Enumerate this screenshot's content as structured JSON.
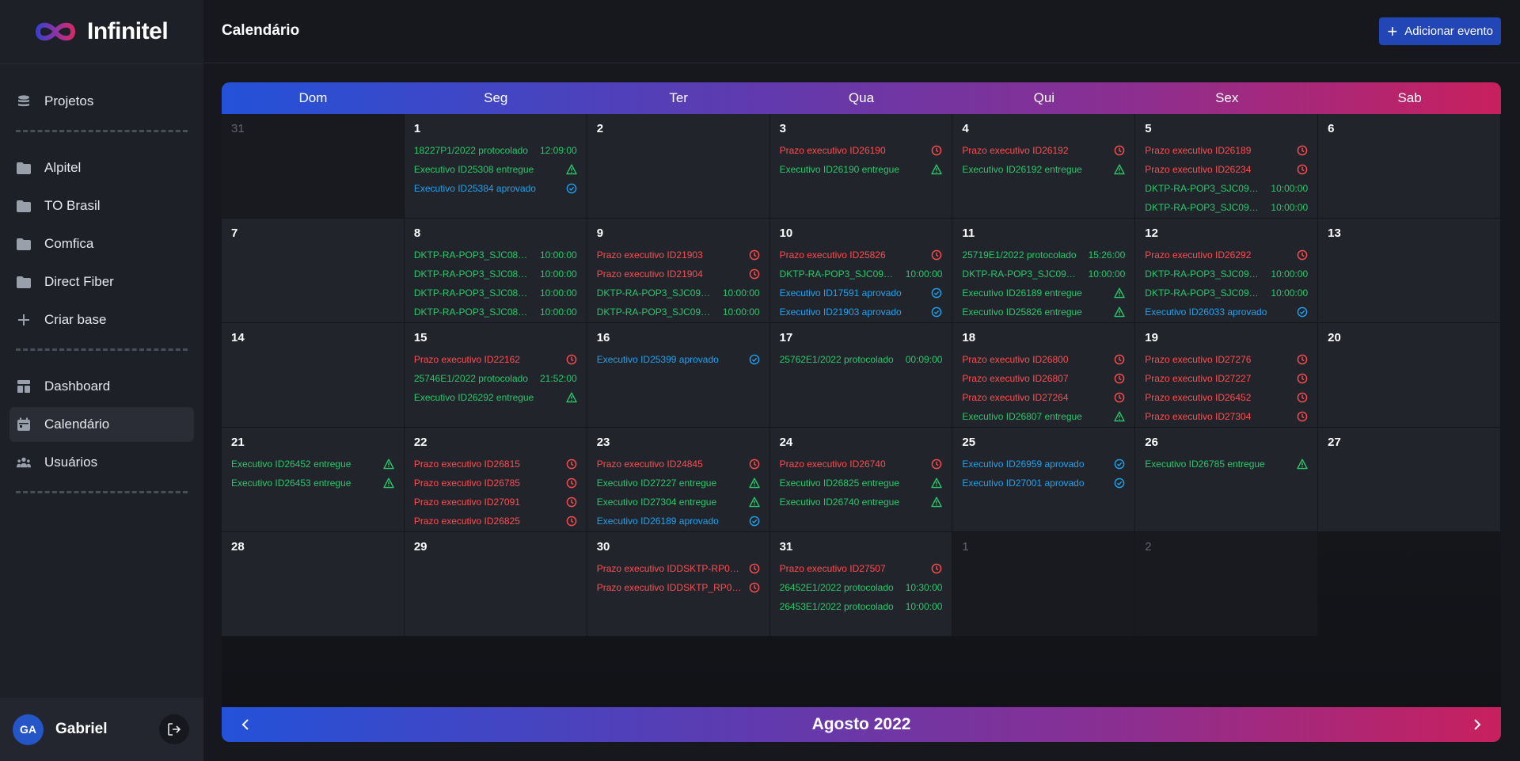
{
  "app": {
    "name": "Infinitel"
  },
  "colors": {
    "red": "#ff4d4f",
    "green": "#27c96a",
    "blue": "#1fa2ef",
    "accent": "#2346b6"
  },
  "sidebar": {
    "items_top": [
      {
        "label": "Projetos",
        "icon": "database-icon"
      }
    ],
    "items_projects": [
      {
        "label": "Alpitel",
        "icon": "folder-icon"
      },
      {
        "label": "TO Brasil",
        "icon": "folder-icon"
      },
      {
        "label": "Comfica",
        "icon": "folder-icon"
      },
      {
        "label": "Direct Fiber",
        "icon": "folder-icon"
      },
      {
        "label": "Criar base",
        "icon": "plus-icon"
      }
    ],
    "items_bottom": [
      {
        "label": "Dashboard",
        "icon": "dashboard-icon",
        "active": false
      },
      {
        "label": "Calendário",
        "icon": "calendar-icon",
        "active": true
      },
      {
        "label": "Usuários",
        "icon": "users-icon",
        "active": false
      }
    ],
    "user": {
      "initials": "GA",
      "name": "Gabriel"
    }
  },
  "header": {
    "title": "Calendário",
    "add_button": "Adicionar evento"
  },
  "calendar": {
    "month_label": "Agosto 2022",
    "weekdays": [
      "Dom",
      "Seg",
      "Ter",
      "Qua",
      "Qui",
      "Sex",
      "Sab"
    ],
    "weeks": [
      [
        {
          "day": "31",
          "outside": true,
          "events": []
        },
        {
          "day": "1",
          "events": [
            {
              "label": "18227P1/2022 protocolado",
              "time": "12:09:00",
              "type": "green"
            },
            {
              "label": "Executivo ID25308 entregue",
              "icon": "warning-icon",
              "type": "green"
            },
            {
              "label": "Executivo ID25384 aprovado",
              "icon": "check-icon",
              "type": "blue"
            }
          ]
        },
        {
          "day": "2",
          "events": []
        },
        {
          "day": "3",
          "events": [
            {
              "label": "Prazo executivo ID26190",
              "icon": "clock-icon",
              "type": "red"
            },
            {
              "label": "Executivo ID26190 entregue",
              "icon": "warning-icon",
              "type": "green"
            }
          ]
        },
        {
          "day": "4",
          "events": [
            {
              "label": "Prazo executivo ID26192",
              "icon": "clock-icon",
              "type": "red"
            },
            {
              "label": "Executivo ID26192 entregue",
              "icon": "warning-icon",
              "type": "green"
            }
          ]
        },
        {
          "day": "5",
          "events": [
            {
              "label": "Prazo executivo ID26189",
              "icon": "clock-icon",
              "type": "red"
            },
            {
              "label": "Prazo executivo ID26234",
              "icon": "clock-icon",
              "type": "red"
            },
            {
              "label": "DKTP-RA-POP3_SJC09E1/...",
              "time": "10:00:00",
              "type": "green"
            },
            {
              "label": "DKTP-RA-POP3_SJC09E1/...",
              "time": "10:00:00",
              "type": "green"
            }
          ]
        },
        {
          "day": "6",
          "events": []
        }
      ],
      [
        {
          "day": "7",
          "events": []
        },
        {
          "day": "8",
          "events": [
            {
              "label": "DKTP-RA-POP3_SJC08E6/...",
              "time": "10:00:00",
              "type": "green"
            },
            {
              "label": "DKTP-RA-POP3_SJC08E7/...",
              "time": "10:00:00",
              "type": "green"
            },
            {
              "label": "DKTP-RA-POP3_SJC08E8/...",
              "time": "10:00:00",
              "type": "green"
            },
            {
              "label": "DKTP-RA-POP3_SJC08E9/...",
              "time": "10:00:00",
              "type": "green"
            }
          ]
        },
        {
          "day": "9",
          "events": [
            {
              "label": "Prazo executivo ID21903",
              "icon": "clock-icon",
              "type": "red"
            },
            {
              "label": "Prazo executivo ID21904",
              "icon": "clock-icon",
              "type": "red"
            },
            {
              "label": "DKTP-RA-POP3_SJC09E2/...",
              "time": "10:00:00",
              "type": "green"
            },
            {
              "label": "DKTP-RA-POP3_SJC09E3/...",
              "time": "10:00:00",
              "type": "green"
            }
          ]
        },
        {
          "day": "10",
          "events": [
            {
              "label": "Prazo executivo ID25826",
              "icon": "clock-icon",
              "type": "red"
            },
            {
              "label": "DKTP-RA-POP3_SJC09E4/...",
              "time": "10:00:00",
              "type": "green"
            },
            {
              "label": "Executivo ID17591 aprovado",
              "icon": "check-icon",
              "type": "blue"
            },
            {
              "label": "Executivo ID21903 aprovado",
              "icon": "check-icon",
              "type": "blue"
            }
          ]
        },
        {
          "day": "11",
          "events": [
            {
              "label": "25719E1/2022 protocolado",
              "time": "15:26:00",
              "type": "green"
            },
            {
              "label": "DKTP-RA-POP3_SJC09E5/...",
              "time": "10:00:00",
              "type": "green"
            },
            {
              "label": "Executivo ID26189 entregue",
              "icon": "warning-icon",
              "type": "green"
            },
            {
              "label": "Executivo ID25826 entregue",
              "icon": "warning-icon",
              "type": "green"
            }
          ]
        },
        {
          "day": "12",
          "events": [
            {
              "label": "Prazo executivo ID26292",
              "icon": "clock-icon",
              "type": "red"
            },
            {
              "label": "DKTP-RA-POP3_SJC09E6/...",
              "time": "10:00:00",
              "type": "green"
            },
            {
              "label": "DKTP-RA-POP3_SJC09E7/...",
              "time": "10:00:00",
              "type": "green"
            },
            {
              "label": "Executivo ID26033 aprovado",
              "icon": "check-icon",
              "type": "blue"
            }
          ]
        },
        {
          "day": "13",
          "events": []
        }
      ],
      [
        {
          "day": "14",
          "events": []
        },
        {
          "day": "15",
          "events": [
            {
              "label": "Prazo executivo ID22162",
              "icon": "clock-icon",
              "type": "red"
            },
            {
              "label": "25746E1/2022 protocolado",
              "time": "21:52:00",
              "type": "green"
            },
            {
              "label": "Executivo ID26292 entregue",
              "icon": "warning-icon",
              "type": "green"
            }
          ]
        },
        {
          "day": "16",
          "events": [
            {
              "label": "Executivo ID25399 aprovado",
              "icon": "check-icon",
              "type": "blue"
            }
          ]
        },
        {
          "day": "17",
          "events": [
            {
              "label": "25762E1/2022 protocolado",
              "time": "00:09:00",
              "type": "green"
            }
          ]
        },
        {
          "day": "18",
          "events": [
            {
              "label": "Prazo executivo ID26800",
              "icon": "clock-icon",
              "type": "red"
            },
            {
              "label": "Prazo executivo ID26807",
              "icon": "clock-icon",
              "type": "red"
            },
            {
              "label": "Prazo executivo ID27264",
              "icon": "clock-icon",
              "type": "red"
            },
            {
              "label": "Executivo ID26807 entregue",
              "icon": "warning-icon",
              "type": "green"
            }
          ]
        },
        {
          "day": "19",
          "events": [
            {
              "label": "Prazo executivo ID27276",
              "icon": "clock-icon",
              "type": "red"
            },
            {
              "label": "Prazo executivo ID27227",
              "icon": "clock-icon",
              "type": "red"
            },
            {
              "label": "Prazo executivo ID26452",
              "icon": "clock-icon",
              "type": "red"
            },
            {
              "label": "Prazo executivo ID27304",
              "icon": "clock-icon",
              "type": "red"
            }
          ]
        },
        {
          "day": "20",
          "events": []
        }
      ],
      [
        {
          "day": "21",
          "events": [
            {
              "label": "Executivo ID26452 entregue",
              "icon": "warning-icon",
              "type": "green"
            },
            {
              "label": "Executivo ID26453 entregue",
              "icon": "warning-icon",
              "type": "green"
            }
          ]
        },
        {
          "day": "22",
          "events": [
            {
              "label": "Prazo executivo ID26815",
              "icon": "clock-icon",
              "type": "red"
            },
            {
              "label": "Prazo executivo ID26785",
              "icon": "clock-icon",
              "type": "red"
            },
            {
              "label": "Prazo executivo ID27091",
              "icon": "clock-icon",
              "type": "red"
            },
            {
              "label": "Prazo executivo ID26825",
              "icon": "clock-icon",
              "type": "red"
            }
          ]
        },
        {
          "day": "23",
          "events": [
            {
              "label": "Prazo executivo ID24845",
              "icon": "clock-icon",
              "type": "red"
            },
            {
              "label": "Executivo ID27227 entregue",
              "icon": "warning-icon",
              "type": "green"
            },
            {
              "label": "Executivo ID27304 entregue",
              "icon": "warning-icon",
              "type": "green"
            },
            {
              "label": "Executivo ID26189 aprovado",
              "icon": "check-icon",
              "type": "blue"
            }
          ]
        },
        {
          "day": "24",
          "events": [
            {
              "label": "Prazo executivo ID26740",
              "icon": "clock-icon",
              "type": "red"
            },
            {
              "label": "Executivo ID26825 entregue",
              "icon": "warning-icon",
              "type": "green"
            },
            {
              "label": "Executivo ID26740 entregue",
              "icon": "warning-icon",
              "type": "green"
            }
          ]
        },
        {
          "day": "25",
          "events": [
            {
              "label": "Executivo ID26959 aprovado",
              "icon": "check-icon",
              "type": "blue"
            },
            {
              "label": "Executivo ID27001 aprovado",
              "icon": "check-icon",
              "type": "blue"
            }
          ]
        },
        {
          "day": "26",
          "events": [
            {
              "label": "Executivo ID26785 entregue",
              "icon": "warning-icon",
              "type": "green"
            }
          ]
        },
        {
          "day": "27",
          "events": []
        }
      ],
      [
        {
          "day": "28",
          "events": []
        },
        {
          "day": "29",
          "events": []
        },
        {
          "day": "30",
          "events": [
            {
              "label": "Prazo executivo IDDSKTP-RP01-RE...",
              "icon": "clock-icon",
              "type": "red"
            },
            {
              "label": "Prazo executivo IDDSKTP_RP01_RE...",
              "icon": "clock-icon",
              "type": "red"
            }
          ]
        },
        {
          "day": "31",
          "events": [
            {
              "label": "Prazo executivo ID27507",
              "icon": "clock-icon",
              "type": "red"
            },
            {
              "label": "26452E1/2022 protocolado",
              "time": "10:30:00",
              "type": "green"
            },
            {
              "label": "26453E1/2022 protocolado",
              "time": "10:00:00",
              "type": "green"
            }
          ]
        },
        {
          "day": "1",
          "outside": true,
          "events": []
        },
        {
          "day": "2",
          "outside": true,
          "events": []
        },
        {
          "empty": true
        }
      ]
    ]
  }
}
